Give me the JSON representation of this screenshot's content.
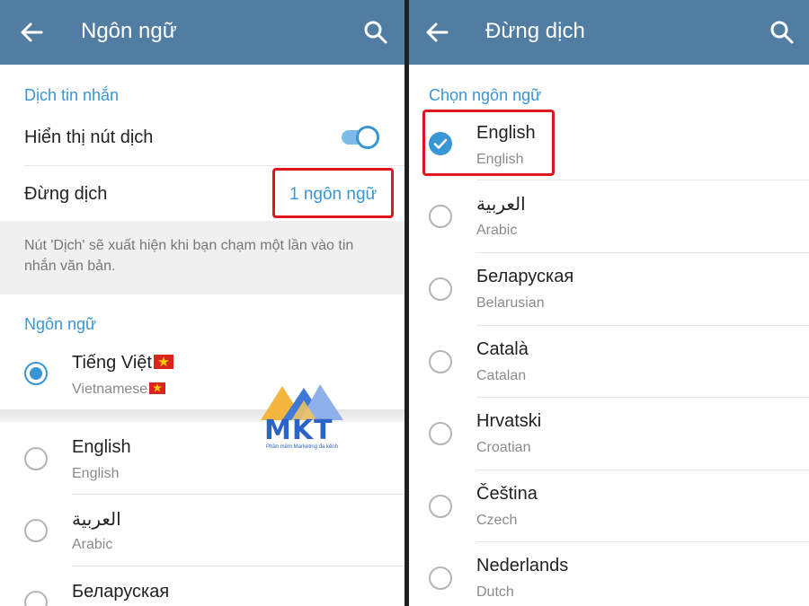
{
  "left": {
    "title": "Ngôn ngữ",
    "translate_section": "Dịch tin nhắn",
    "show_translate_label": "Hiển thị nút dịch",
    "show_translate_enabled": true,
    "do_not_translate_label": "Đừng dịch",
    "do_not_translate_value": "1 ngôn ngữ",
    "hint": "Nút 'Dịch' sẽ xuất hiện khi bạn chạm một lần vào tin nhắn văn bản.",
    "language_section": "Ngôn ngữ",
    "languages": [
      {
        "name": "Tiếng Việt",
        "sub": "Vietnamese",
        "selected": true
      },
      {
        "name": "English",
        "sub": "English",
        "selected": false
      },
      {
        "name": "العربية",
        "sub": "Arabic",
        "selected": false
      },
      {
        "name": "Беларуская",
        "sub": "",
        "selected": false
      }
    ]
  },
  "right": {
    "title": "Đừng dịch",
    "section": "Chọn ngôn ngữ",
    "languages": [
      {
        "name": "English",
        "sub": "English",
        "checked": true
      },
      {
        "name": "العربية",
        "sub": "Arabic",
        "checked": false
      },
      {
        "name": "Беларуская",
        "sub": "Belarusian",
        "checked": false
      },
      {
        "name": "Català",
        "sub": "Catalan",
        "checked": false
      },
      {
        "name": "Hrvatski",
        "sub": "Croatian",
        "checked": false
      },
      {
        "name": "Čeština",
        "sub": "Czech",
        "checked": false
      },
      {
        "name": "Nederlands",
        "sub": "Dutch",
        "checked": false
      }
    ]
  },
  "watermark": {
    "brand": "MKT",
    "tagline": "Phần mềm Marketing đa kênh"
  },
  "colors": {
    "appbar": "#517da2",
    "accent": "#3a95d5",
    "highlight": "#e0171f"
  },
  "icons": [
    "back-arrow-icon",
    "search-icon",
    "vietnam-flag-icon",
    "checkmark-icon"
  ]
}
